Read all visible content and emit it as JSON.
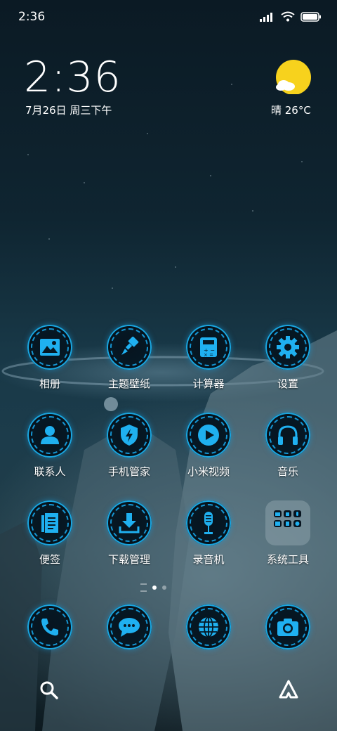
{
  "status_bar": {
    "time": "2:36"
  },
  "clock_widget": {
    "time": "2:36",
    "date": "7月26日 周三下午"
  },
  "weather_widget": {
    "text": "晴 26°C"
  },
  "apps": [
    {
      "label": "相册",
      "icon": "gallery-icon"
    },
    {
      "label": "主题壁纸",
      "icon": "paintbrush-icon"
    },
    {
      "label": "计算器",
      "icon": "calculator-icon"
    },
    {
      "label": "设置",
      "icon": "gear-icon"
    },
    {
      "label": "联系人",
      "icon": "person-icon"
    },
    {
      "label": "手机管家",
      "icon": "shield-bolt-icon"
    },
    {
      "label": "小米视频",
      "icon": "play-icon"
    },
    {
      "label": "音乐",
      "icon": "headphones-icon"
    },
    {
      "label": "便签",
      "icon": "notes-icon"
    },
    {
      "label": "下载管理",
      "icon": "download-icon"
    },
    {
      "label": "录音机",
      "icon": "microphone-icon"
    },
    {
      "label": "系统工具",
      "icon": "folder-icon"
    }
  ],
  "dock": [
    {
      "icon": "phone-icon"
    },
    {
      "icon": "message-icon"
    },
    {
      "icon": "browser-globe-icon"
    },
    {
      "icon": "camera-icon"
    }
  ],
  "page_indicator": {
    "count": 3,
    "active": 1
  },
  "colors": {
    "accent": "#17a3e6",
    "icon_bg": "#061824",
    "sun": "#f7d21d"
  }
}
